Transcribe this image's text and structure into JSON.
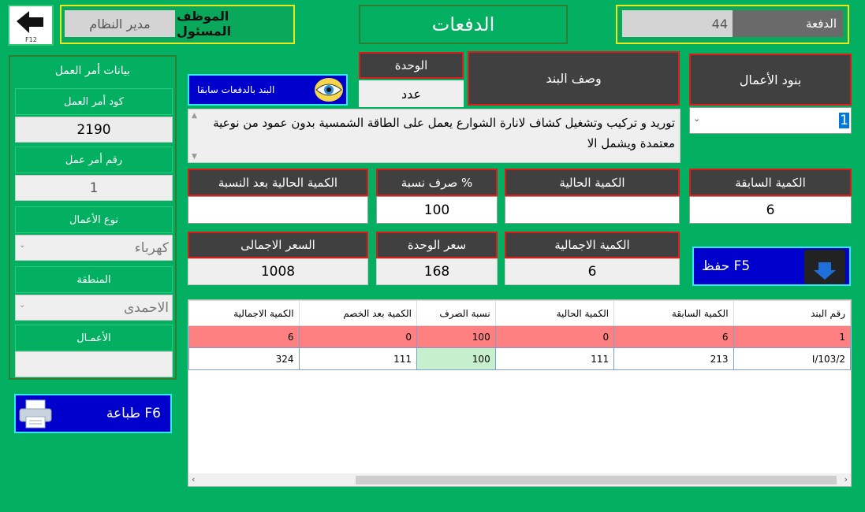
{
  "header": {
    "back_key": "F12",
    "officer_label": "الموظف المسئول",
    "officer_value": "مدير النظام",
    "title": "الدفعات",
    "payment_label": "الدفعة",
    "payment_value": "44"
  },
  "sidebar": {
    "title": "بيانات أمر العمل",
    "order_code_label": "كود أمر العمل",
    "order_code_value": "2190",
    "order_number_label": "رقم أمر عمل",
    "order_number_value": "1",
    "work_type_label": "نوع الأعمال",
    "work_type_value": "كهرباء",
    "region_label": "المنطقة",
    "region_value": "الاحمدى",
    "works_label": "الأعمـال",
    "works_value": "",
    "print_button": "طباعة F6"
  },
  "item": {
    "items_label": "بنود الأعمال",
    "items_value": "1",
    "desc_label": "وصف البند",
    "unit_label": "الوحدة",
    "unit_value": "عدد",
    "prev_payments_button": "البند بالدفعات سابقا",
    "description": "توريد و تركيب وتشغيل كشاف لانارة الشوارع يعمل على الطاقة الشمسية بدون عمود من نوعية معتمدة ويشمل الا"
  },
  "quantities": {
    "prev_qty_label": "الكمية السابقة",
    "prev_qty_value": "6",
    "curr_qty_label": "الكمية الحالية",
    "curr_qty_value": "",
    "pct_label": "صرف نسبة  %",
    "pct_value": "100",
    "curr_after_pct_label": "الكمية الحالية بعد النسبة",
    "curr_after_pct_value": "",
    "total_qty_label": "الكمية الاجمالية",
    "total_qty_value": "6",
    "unit_price_label": "سعر الوحدة",
    "unit_price_value": "168",
    "total_price_label": "السعر الاجمالى",
    "total_price_value": "1008",
    "save_button": "حفظ F5"
  },
  "table": {
    "columns": [
      "رقم البند",
      "الكمية السابقة",
      "الكمية الحالية",
      "نسبة الصرف",
      "الكمية بعد الخصم",
      "الكمية الاجمالية"
    ],
    "rows": [
      [
        "1",
        "6",
        "0",
        "100",
        "0",
        "6"
      ],
      [
        "I/103/2",
        "213",
        "111",
        "100",
        "111",
        "324"
      ]
    ]
  },
  "colors": {
    "background": "#03b062",
    "dark_label": "#404040",
    "label_border": "#e01a1a",
    "button_blue": "#0000cc",
    "selected_row": "#ff8080",
    "highlight_cell": "#c6efce"
  }
}
